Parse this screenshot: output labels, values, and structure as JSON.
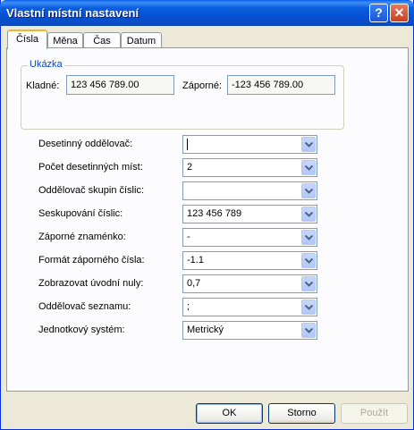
{
  "window": {
    "title": "Vlastní místní nastavení"
  },
  "tabs": [
    {
      "label": "Čísla",
      "active": true
    },
    {
      "label": "Měna",
      "active": false
    },
    {
      "label": "Čas",
      "active": false
    },
    {
      "label": "Datum",
      "active": false
    }
  ],
  "sample": {
    "title": "Ukázka",
    "positive_label": "Kladné:",
    "positive_value": "123 456 789.00",
    "negative_label": "Záporné:",
    "negative_value": "-123 456 789.00"
  },
  "settings": [
    {
      "label": "Desetinný oddělovač:",
      "value": ""
    },
    {
      "label": "Počet desetinných míst:",
      "value": "2"
    },
    {
      "label": "Oddělovač skupin číslic:",
      "value": ""
    },
    {
      "label": "Seskupování číslic:",
      "value": "123 456 789"
    },
    {
      "label": "Záporné znaménko:",
      "value": "-"
    },
    {
      "label": "Formát záporného čísla:",
      "value": "-1.1"
    },
    {
      "label": "Zobrazovat úvodní nuly:",
      "value": "0,7"
    },
    {
      "label": "Oddělovač seznamu:",
      "value": ";"
    },
    {
      "label": "Jednotkový systém:",
      "value": "Metrický"
    }
  ],
  "buttons": {
    "ok": "OK",
    "cancel": "Storno",
    "apply": "Použít"
  },
  "icons": {
    "help": "help-icon",
    "close": "close-icon",
    "dropdown": "chevron-down-icon"
  },
  "colors": {
    "titlebar": "#0a5fe8",
    "group_title": "#0046d5",
    "tab_highlight": "#f0b431"
  }
}
